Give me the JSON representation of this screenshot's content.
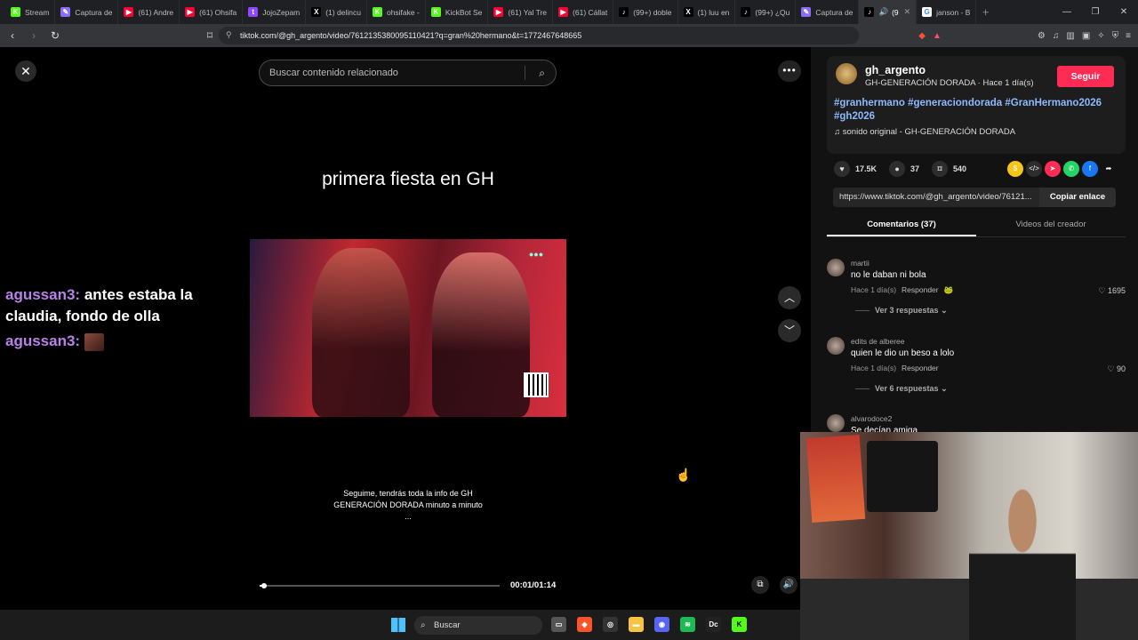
{
  "browser": {
    "tabs": [
      {
        "label": "Stream",
        "icon": "kick-icon",
        "color": "#53fc18"
      },
      {
        "label": "Captura de",
        "icon": "pen-icon",
        "color": "#8a6cff"
      },
      {
        "label": "(61) Andre",
        "icon": "youtube-icon",
        "color": "#ff0033"
      },
      {
        "label": "(61) Ohsifa",
        "icon": "youtube-icon",
        "color": "#ff0033"
      },
      {
        "label": "JojoZepam",
        "icon": "twitch-icon",
        "color": "#9146ff"
      },
      {
        "label": "(1) delincu",
        "icon": "x-icon",
        "color": "#000000"
      },
      {
        "label": "ohsifake -",
        "icon": "kick-icon",
        "color": "#53fc18"
      },
      {
        "label": "KickBot Se",
        "icon": "kickbot-icon",
        "color": "#53fc18"
      },
      {
        "label": "(61) Yal Tre",
        "icon": "youtube-icon",
        "color": "#ff0033"
      },
      {
        "label": "(61) Cállat",
        "icon": "youtube-icon",
        "color": "#ff0033"
      },
      {
        "label": "(99+) doble",
        "icon": "tiktok-icon",
        "color": "#000000"
      },
      {
        "label": "(1) luu en",
        "icon": "x-icon",
        "color": "#000000"
      },
      {
        "label": "(99+) ¿Qu",
        "icon": "tiktok-icon",
        "color": "#000000"
      },
      {
        "label": "Captura de",
        "icon": "pen-icon",
        "color": "#8a6cff"
      },
      {
        "label": "(9",
        "icon": "tiktok-icon",
        "color": "#000000",
        "active": true
      },
      {
        "label": "janson - B",
        "icon": "google-icon",
        "color": "#ffffff"
      }
    ],
    "url": "tiktok.com/@gh_argento/video/7612135380095110421?q=gran%20hermano&t=1772467648665"
  },
  "search": {
    "placeholder": "Buscar contenido relacionado"
  },
  "video": {
    "title": "primera fiesta en GH",
    "caption": "Seguime, tendrás toda la info de GH GENERACIÓN DORADA minuto a minuto ...",
    "time": "00:01/01:14",
    "progress": 0.02
  },
  "chat": [
    {
      "user": "agussan3:",
      "message": "antes estaba la claudia, fondo de olla"
    },
    {
      "user": "agussan3:",
      "message": "",
      "emote": "emote-icon"
    }
  ],
  "author": {
    "name": "gh_argento",
    "subtitle": "GH-GENERACIÓN DORADA · Hace 1 día(s)",
    "follow_label": "Seguir",
    "hashtags": "#granhermano #generaciondorada #GranHermano2026 #gh2026",
    "sound": "sonido original - GH-GENERACIÓN DORADA"
  },
  "stats": {
    "likes": "17.5K",
    "comments": "37",
    "saves": "540"
  },
  "link": {
    "url": "https://www.tiktok.com/@gh_argento/video/76121...",
    "copy_label": "Copiar enlace"
  },
  "panel_tabs": {
    "comments": "Comentarios (37)",
    "creator_videos": "Videos del creador"
  },
  "comments": [
    {
      "user": "martii",
      "text": "no le daban ni bola",
      "time": "Hace 1 día(s)",
      "reply": "Responder",
      "likes": "1695",
      "replies": "Ver 3 respuestas"
    },
    {
      "user": "edits de alberee",
      "text": "quien le dio un beso a lolo",
      "time": "Hace 1 día(s)",
      "reply": "Responder",
      "likes": "90",
      "replies": "Ver 6 respuestas"
    },
    {
      "user": "alvarodoce2",
      "text": "Se decían amiga",
      "time": "",
      "reply": "",
      "likes": "",
      "replies": ""
    }
  ],
  "taskbar": {
    "search_label": "Buscar"
  },
  "colors": {
    "accent": "#fe2c55",
    "chat_user": "#b882e8",
    "hashtag": "#8fb9ff"
  }
}
